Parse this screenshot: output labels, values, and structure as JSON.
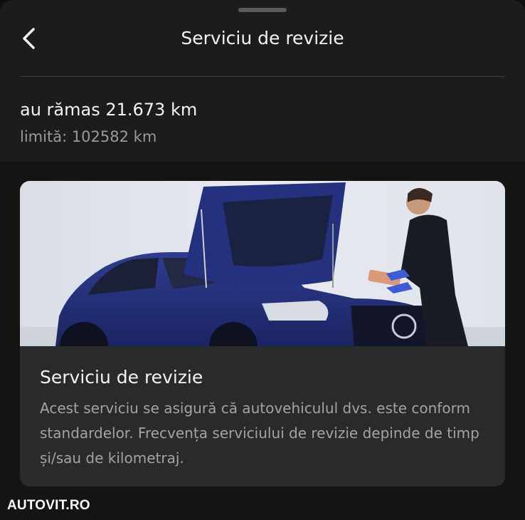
{
  "header": {
    "title": "Serviciu de revizie",
    "back_icon": "chevron-left-icon"
  },
  "summary": {
    "remaining": "au rămas 21.673 km",
    "limit": "limită: 102582 km"
  },
  "card": {
    "image_description_icon": "car-service-photo",
    "title": "Serviciu de revizie",
    "description": "Acest serviciu se asigură că autovehiculul dvs. este conform standardelor. Frecvența serviciului de revizie depinde de timp și/sau de kilometraj."
  },
  "watermark": {
    "text": "AUTOVIT.RO"
  },
  "colors": {
    "background": "#1c1c1c",
    "content_background": "#141414",
    "card_background": "#2a2a2a",
    "primary_text": "#f4f4f4",
    "secondary_text": "#9a9a9a",
    "car_blue": "#23317a"
  }
}
